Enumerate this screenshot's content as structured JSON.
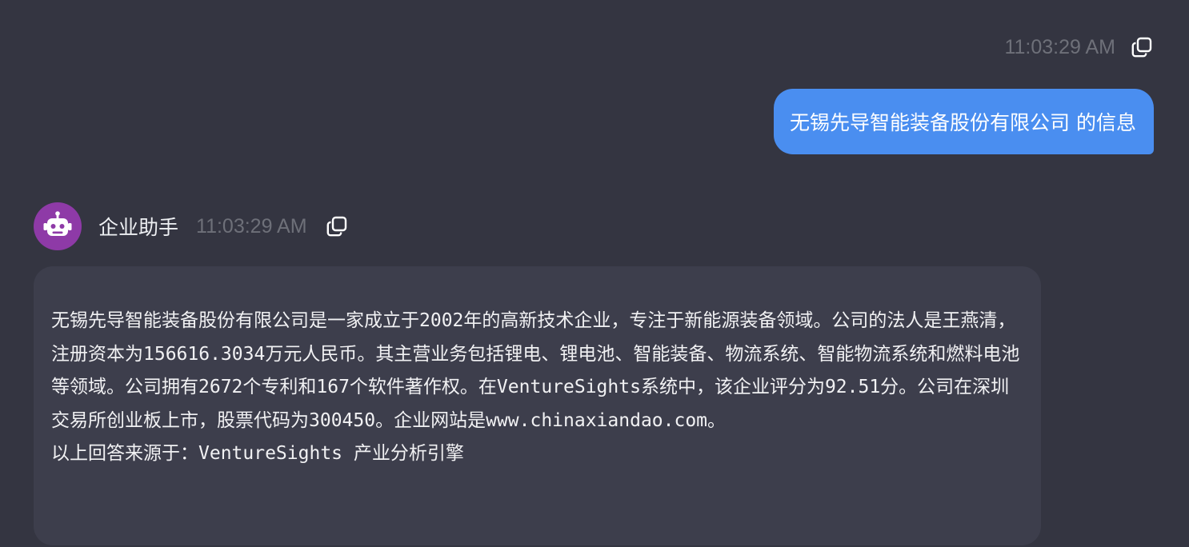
{
  "user_message": {
    "timestamp": "11:03:29 AM",
    "text": "无锡先导智能装备股份有限公司 的信息",
    "copy_icon": "copy-icon",
    "bubble_color": "#4a8ef0"
  },
  "assistant_message": {
    "name": "企业助手",
    "timestamp": "11:03:29 AM",
    "avatar_icon": "robot-icon",
    "avatar_color": "#8e3aa7",
    "copy_icon": "copy-icon",
    "paragraphs": [
      "无锡先导智能装备股份有限公司是一家成立于2002年的高新技术企业，专注于新能源装备领域。公司的法人是王燕清，注册资本为156616.3034万元人民币。其主营业务包括锂电、锂电池、智能装备、物流系统、智能物流系统和燃料电池等领域。公司拥有2672个专利和167个软件著作权。在VentureSights系统中，该企业评分为92.51分。公司在深圳交易所创业板上市，股票代码为300450。企业网站是www.chinaxiandao.com。",
      "以上回答来源于：VentureSights 产业分析引擎"
    ]
  },
  "theme": {
    "background": "#343541",
    "assistant_bubble": "#3d3e4c",
    "timestamp_color": "#6e7079"
  }
}
